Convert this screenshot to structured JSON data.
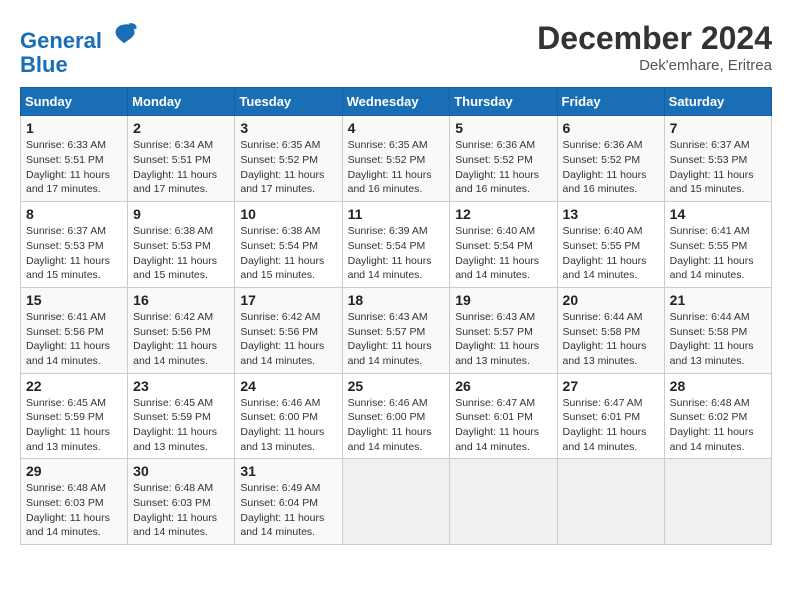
{
  "header": {
    "logo_line1": "General",
    "logo_line2": "Blue",
    "month_title": "December 2024",
    "location": "Dek'emhare, Eritrea"
  },
  "weekdays": [
    "Sunday",
    "Monday",
    "Tuesday",
    "Wednesday",
    "Thursday",
    "Friday",
    "Saturday"
  ],
  "weeks": [
    [
      {
        "day": "1",
        "sunrise": "6:33 AM",
        "sunset": "5:51 PM",
        "daylight": "11 hours and 17 minutes."
      },
      {
        "day": "2",
        "sunrise": "6:34 AM",
        "sunset": "5:51 PM",
        "daylight": "11 hours and 17 minutes."
      },
      {
        "day": "3",
        "sunrise": "6:35 AM",
        "sunset": "5:52 PM",
        "daylight": "11 hours and 17 minutes."
      },
      {
        "day": "4",
        "sunrise": "6:35 AM",
        "sunset": "5:52 PM",
        "daylight": "11 hours and 16 minutes."
      },
      {
        "day": "5",
        "sunrise": "6:36 AM",
        "sunset": "5:52 PM",
        "daylight": "11 hours and 16 minutes."
      },
      {
        "day": "6",
        "sunrise": "6:36 AM",
        "sunset": "5:52 PM",
        "daylight": "11 hours and 16 minutes."
      },
      {
        "day": "7",
        "sunrise": "6:37 AM",
        "sunset": "5:53 PM",
        "daylight": "11 hours and 15 minutes."
      }
    ],
    [
      {
        "day": "8",
        "sunrise": "6:37 AM",
        "sunset": "5:53 PM",
        "daylight": "11 hours and 15 minutes."
      },
      {
        "day": "9",
        "sunrise": "6:38 AM",
        "sunset": "5:53 PM",
        "daylight": "11 hours and 15 minutes."
      },
      {
        "day": "10",
        "sunrise": "6:38 AM",
        "sunset": "5:54 PM",
        "daylight": "11 hours and 15 minutes."
      },
      {
        "day": "11",
        "sunrise": "6:39 AM",
        "sunset": "5:54 PM",
        "daylight": "11 hours and 14 minutes."
      },
      {
        "day": "12",
        "sunrise": "6:40 AM",
        "sunset": "5:54 PM",
        "daylight": "11 hours and 14 minutes."
      },
      {
        "day": "13",
        "sunrise": "6:40 AM",
        "sunset": "5:55 PM",
        "daylight": "11 hours and 14 minutes."
      },
      {
        "day": "14",
        "sunrise": "6:41 AM",
        "sunset": "5:55 PM",
        "daylight": "11 hours and 14 minutes."
      }
    ],
    [
      {
        "day": "15",
        "sunrise": "6:41 AM",
        "sunset": "5:56 PM",
        "daylight": "11 hours and 14 minutes."
      },
      {
        "day": "16",
        "sunrise": "6:42 AM",
        "sunset": "5:56 PM",
        "daylight": "11 hours and 14 minutes."
      },
      {
        "day": "17",
        "sunrise": "6:42 AM",
        "sunset": "5:56 PM",
        "daylight": "11 hours and 14 minutes."
      },
      {
        "day": "18",
        "sunrise": "6:43 AM",
        "sunset": "5:57 PM",
        "daylight": "11 hours and 14 minutes."
      },
      {
        "day": "19",
        "sunrise": "6:43 AM",
        "sunset": "5:57 PM",
        "daylight": "11 hours and 13 minutes."
      },
      {
        "day": "20",
        "sunrise": "6:44 AM",
        "sunset": "5:58 PM",
        "daylight": "11 hours and 13 minutes."
      },
      {
        "day": "21",
        "sunrise": "6:44 AM",
        "sunset": "5:58 PM",
        "daylight": "11 hours and 13 minutes."
      }
    ],
    [
      {
        "day": "22",
        "sunrise": "6:45 AM",
        "sunset": "5:59 PM",
        "daylight": "11 hours and 13 minutes."
      },
      {
        "day": "23",
        "sunrise": "6:45 AM",
        "sunset": "5:59 PM",
        "daylight": "11 hours and 13 minutes."
      },
      {
        "day": "24",
        "sunrise": "6:46 AM",
        "sunset": "6:00 PM",
        "daylight": "11 hours and 13 minutes."
      },
      {
        "day": "25",
        "sunrise": "6:46 AM",
        "sunset": "6:00 PM",
        "daylight": "11 hours and 14 minutes."
      },
      {
        "day": "26",
        "sunrise": "6:47 AM",
        "sunset": "6:01 PM",
        "daylight": "11 hours and 14 minutes."
      },
      {
        "day": "27",
        "sunrise": "6:47 AM",
        "sunset": "6:01 PM",
        "daylight": "11 hours and 14 minutes."
      },
      {
        "day": "28",
        "sunrise": "6:48 AM",
        "sunset": "6:02 PM",
        "daylight": "11 hours and 14 minutes."
      }
    ],
    [
      {
        "day": "29",
        "sunrise": "6:48 AM",
        "sunset": "6:03 PM",
        "daylight": "11 hours and 14 minutes."
      },
      {
        "day": "30",
        "sunrise": "6:48 AM",
        "sunset": "6:03 PM",
        "daylight": "11 hours and 14 minutes."
      },
      {
        "day": "31",
        "sunrise": "6:49 AM",
        "sunset": "6:04 PM",
        "daylight": "11 hours and 14 minutes."
      },
      null,
      null,
      null,
      null
    ]
  ]
}
